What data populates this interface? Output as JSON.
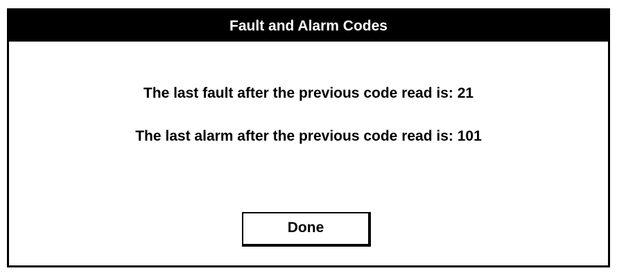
{
  "dialog": {
    "title": "Fault and Alarm Codes",
    "fault_message": "The last fault after the previous code read is: 21",
    "alarm_message": "The last alarm after the previous code read is: 101",
    "done_label": "Done"
  }
}
